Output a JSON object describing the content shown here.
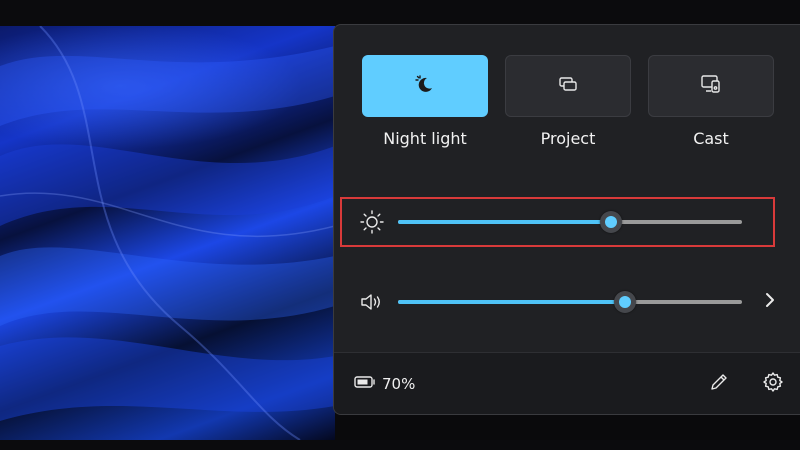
{
  "quick_settings": {
    "tiles": [
      {
        "label": "Night light",
        "icon": "night-light-icon",
        "state": "on"
      },
      {
        "label": "Project",
        "icon": "project-icon",
        "state": "off"
      },
      {
        "label": "Cast",
        "icon": "cast-icon",
        "state": "off"
      }
    ],
    "brightness": {
      "icon": "brightness-icon",
      "level_percent": 62
    },
    "volume": {
      "icon": "volume-icon",
      "level_percent": 66
    },
    "battery": {
      "icon": "battery-icon",
      "percent_label": "70%"
    },
    "footer": {
      "edit_icon": "pencil-icon",
      "settings_icon": "gear-icon"
    }
  },
  "colors": {
    "accent": "#60cdff",
    "highlight_border": "#d83a3a",
    "panel_bg": "#202124"
  }
}
